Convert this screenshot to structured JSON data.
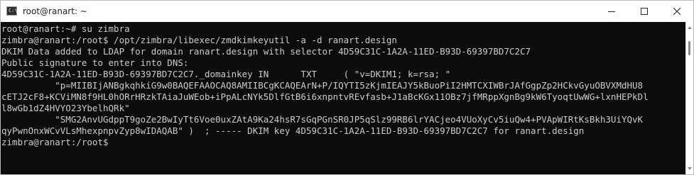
{
  "window": {
    "title": "root@ranart: ~",
    "app_icon": "cmd-icon",
    "app_icon_glyph": "C:\\",
    "controls": [
      "minimize-icon",
      "maximize-icon",
      "close-icon"
    ]
  },
  "terminal": {
    "background": "#0c0c0c",
    "foreground": "#cccccc",
    "lines": [
      "root@ranart:~# su zimbra",
      "zimbra@ranart:/root$ /opt/zimbra/libexec/zmdkimkeyutil -a -d ranart.design",
      "DKIM Data added to LDAP for domain ranart.design with selector 4D59C31C-1A2A-11ED-B93D-69397BD7C2C7",
      "Public signature to enter into DNS:",
      "4D59C31C-1A2A-11ED-B93D-69397BD7C2C7._domainkey IN      TXT     ( \"v=DKIM1; k=rsa; \"",
      "          \"p=MIIBIjANBgkqhkiG9w0BAQEFAAOCAQ8AMIIBCgKCAQEArN+P/IQYTI5zKjmIEAJY5kBuoPiI2HMTCXIWBrJAfGgpZp2HCkvGyuOBVXMdHU8",
      "cETJ2cF8+KCViMN8f9HL0hORrHRzkTAiaJuWEob+iPpALcNYk5DlfGtB6i6xnpntvREvfasb+J1aBcKGx11OBz7jfMRppXgnBg9kW6TyoqtUwWG+lxnHEPkDl",
      "l8wGb1dZ4HVYO23YbelhQRk\"",
      "          \"SMG2AnvUGdppT9goZe2BwIyTt6Voe0uxZAtA9Ka24hsR7sGqPGnSR0JP5qSlz99RB6lrYACjeo4VUoXyCv5iuQw4+PVApWIRtKsBkh3UiYQvK",
      "qyPwnOnxWCvVLsMhexpnpvZyp8wIDAQAB\" )  ; ----- DKIM key 4D59C31C-1A2A-11ED-B93D-69397BD7C2C7 for ranart.design",
      "zimbra@ranart:/root$"
    ]
  },
  "scrollbar": {
    "up_icon": "scroll-up-arrow-icon",
    "down_icon": "scroll-down-arrow-icon"
  }
}
